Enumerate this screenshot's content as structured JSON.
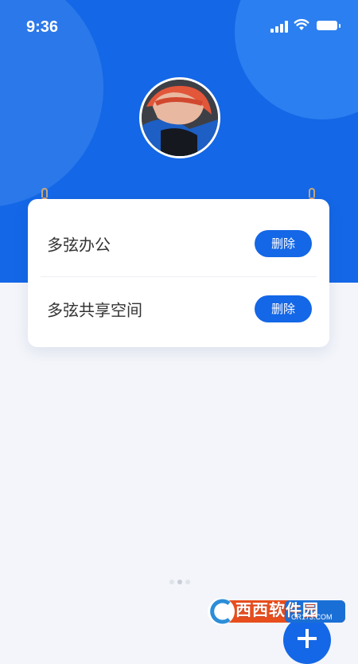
{
  "status_bar": {
    "time": "9:36"
  },
  "icons": {
    "signal": "cellular-signal-icon",
    "wifi": "wifi-icon",
    "battery": "battery-icon",
    "add": "plus-icon"
  },
  "colors": {
    "primary": "#1467e6",
    "page_background": "#f3f5fa",
    "card_background": "#ffffff",
    "text": "#333333"
  },
  "profile": {
    "avatar": "user-avatar"
  },
  "workspaces": [
    {
      "name": "多弦办公",
      "action_label": "删除"
    },
    {
      "name": "多弦共享空间",
      "action_label": "删除"
    }
  ],
  "watermark": {
    "brand": "西西软件园",
    "url": "CR173.COM"
  }
}
